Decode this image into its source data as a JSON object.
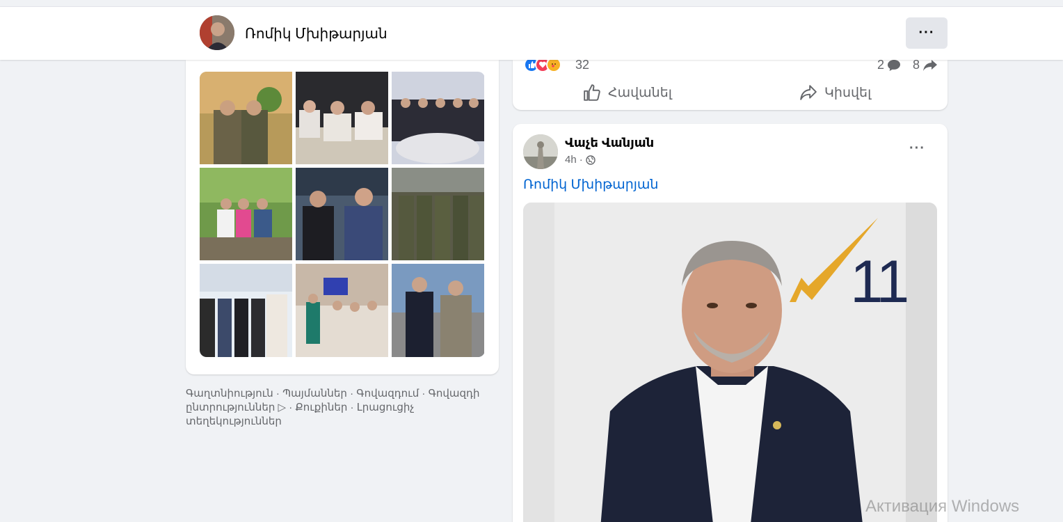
{
  "header": {
    "profile_name": "Ռոմիկ Մխիթարյան",
    "more_label": "···"
  },
  "footer": {
    "links": [
      "Գաղտնիություն",
      "Պայմաններ",
      "Գովազդում",
      "Գովազդի ընտրություններ",
      "Քուքիներ",
      "Լրացուցիչ տեղեկություններ"
    ],
    "separator": " · ",
    "adchoices_glyph": "▷"
  },
  "post_top": {
    "reaction_count": "32",
    "comment_count": "2",
    "share_count": "8",
    "like_label": "Հավանել",
    "share_label": "Կիսվել"
  },
  "post": {
    "author": "Վաչե Վանյան",
    "time": "4h",
    "meta_separator": "·",
    "more_label": "···",
    "link_text": "Ռոմիկ Մխիթարյան",
    "image_number": "11"
  },
  "watermark": "Активация Windows",
  "colors": {
    "link": "#0064d1",
    "like_blue": "#1877f2",
    "love_red": "#f33e58",
    "care_yellow": "#f7b125"
  }
}
